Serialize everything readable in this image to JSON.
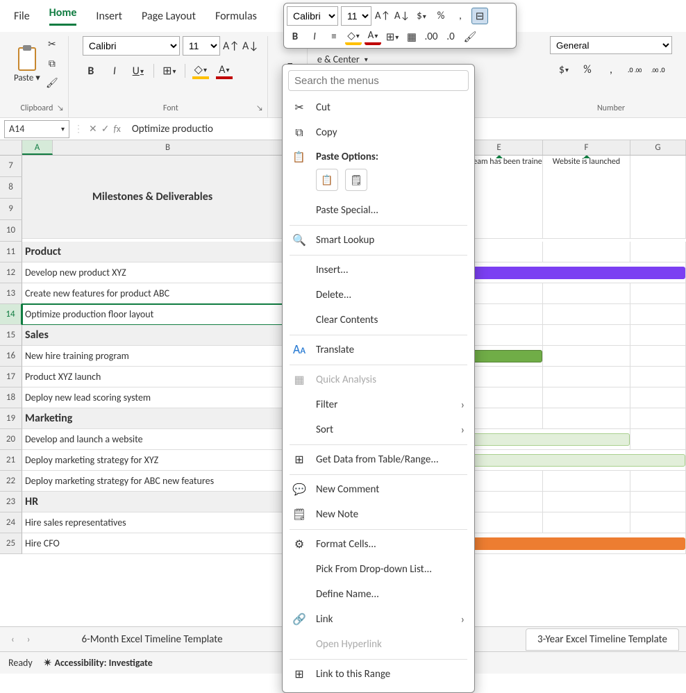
{
  "tabs": {
    "file": "File",
    "home": "Home",
    "insert": "Insert",
    "pagelayout": "Page Layout",
    "formulas": "Formulas"
  },
  "clipboard": {
    "paste": "Paste",
    "label": "Clipboard"
  },
  "font": {
    "name": "Calibri",
    "size": "11",
    "label": "Font",
    "bold": "B",
    "italic": "I",
    "underline": "U"
  },
  "align": {
    "wrap": "Wrap Text",
    "merge": "e & Center"
  },
  "number": {
    "general": "General",
    "label": "Number"
  },
  "namebox": "A14",
  "fxvalue": "Optimize productio",
  "columns": {
    "A": "A",
    "B": "B",
    "E": "E",
    "F": "F",
    "G": "G"
  },
  "rows": {
    "title": "Milestones & Deliverables",
    "r11": "Product",
    "r12": "Develop new product XYZ",
    "r13": "Create new features for product ABC",
    "r14": "Optimize production floor layout",
    "r15": "Sales",
    "r16": "New hire training program",
    "r17": "Product XYZ launch",
    "r18": "Deploy new lead scoring system",
    "r19": "Marketing",
    "r20": "Develop and launch a website",
    "r21": "Deploy marketing strategy for XYZ",
    "r22": "Deploy marketing strategy for ABC new features",
    "r23": "HR",
    "r24": "Hire sales representatives",
    "r25": "Hire CFO"
  },
  "rownums": {
    "r7": "7",
    "r8": "8",
    "r9": "9",
    "r10": "10",
    "r11": "11",
    "r12": "12",
    "r13": "13",
    "r14": "14",
    "r15": "15",
    "r16": "16",
    "r17": "17",
    "r18": "18",
    "r19": "19",
    "r20": "20",
    "r21": "21",
    "r22": "22",
    "r23": "23",
    "r24": "24",
    "r25": "25"
  },
  "callouts": {
    "e": "Sales team has been trained",
    "f": "Website is launched"
  },
  "sheets": {
    "s1": "6-Month Excel Timeline Template",
    "s2": "3-Year Excel Timeline Template"
  },
  "status": {
    "ready": "Ready",
    "acc": "Accessibility: Investigate"
  },
  "mini": {
    "font": "Calibri",
    "size": "11"
  },
  "cm": {
    "search_ph": "Search the menus",
    "cut": "Cut",
    "copy": "Copy",
    "paste_label": "Paste Options:",
    "paste_special": "Paste Special...",
    "smart_lookup": "Smart Lookup",
    "insert": "Insert...",
    "delete": "Delete...",
    "clear": "Clear Contents",
    "translate": "Translate",
    "quick": "Quick Analysis",
    "filter": "Filter",
    "sort": "Sort",
    "getdata": "Get Data from Table/Range...",
    "comment": "New Comment",
    "note": "New Note",
    "format": "Format Cells...",
    "pick": "Pick From Drop-down List...",
    "define": "Define Name...",
    "link": "Link",
    "openhyper": "Open Hyperlink",
    "linkrange": "Link to this Range"
  }
}
